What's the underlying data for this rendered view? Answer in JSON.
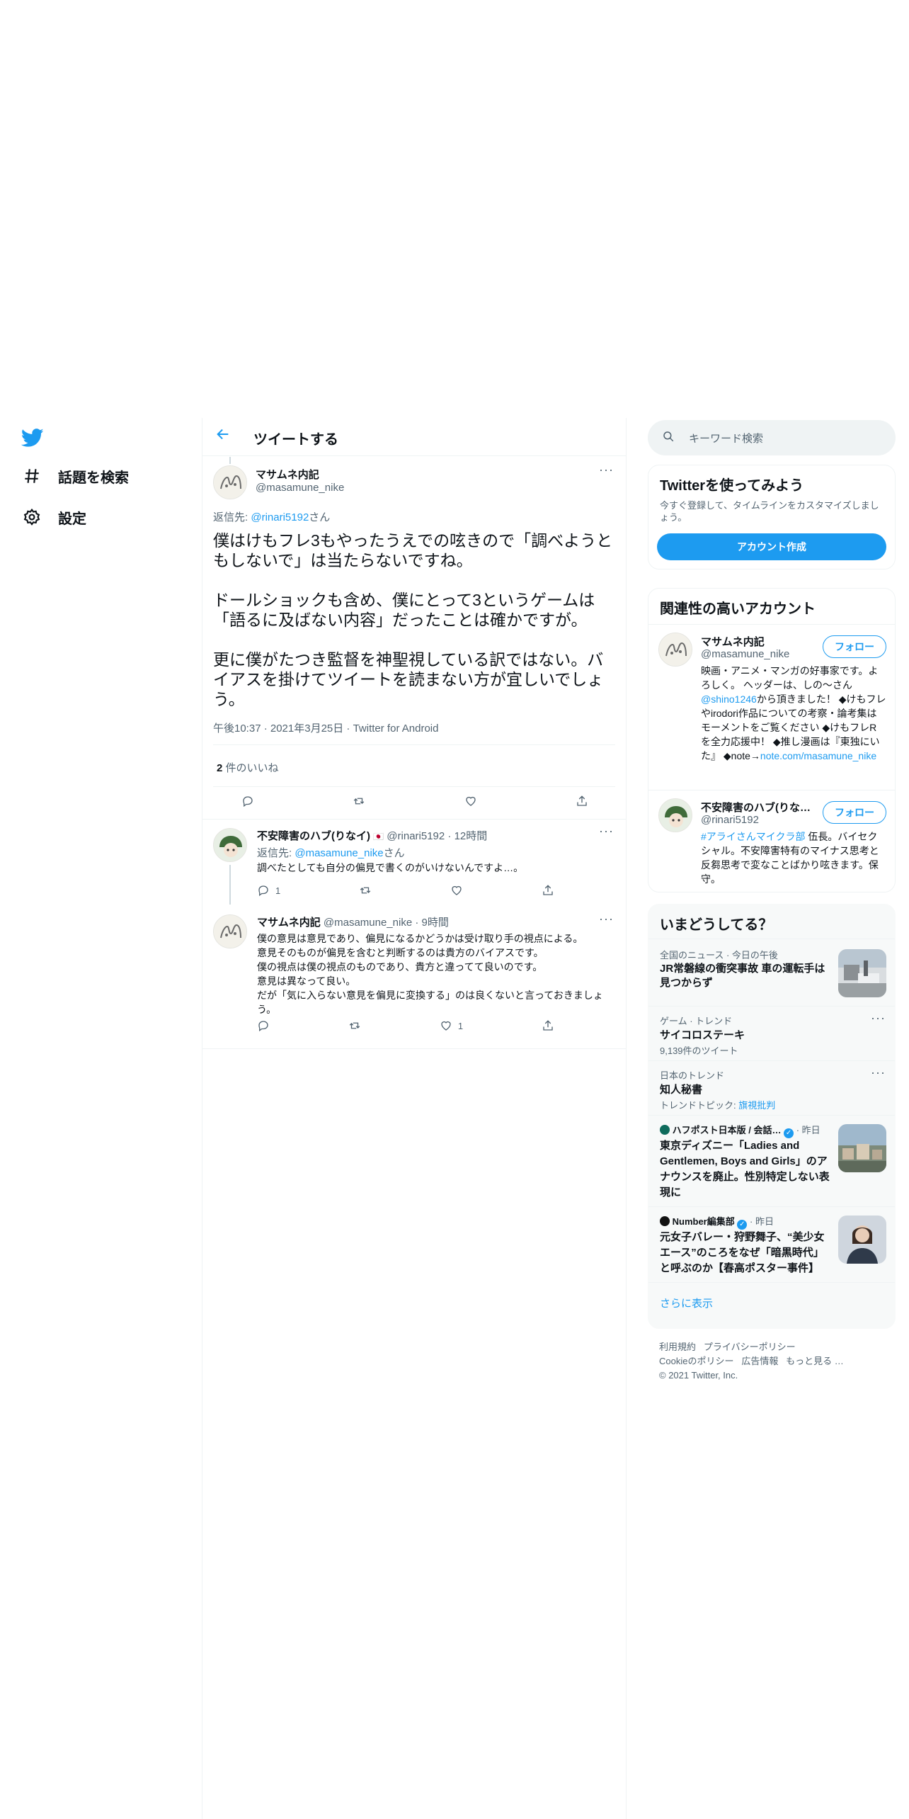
{
  "colors": {
    "accent": "#1d9bf0",
    "text": "#0f1419",
    "muted": "#536471",
    "border": "#eff3f4"
  },
  "nav": {
    "logo": "twitter-bird-icon",
    "items": [
      {
        "icon": "hashtag-icon",
        "label": "話題を検索"
      },
      {
        "icon": "gear-icon",
        "label": "設定"
      }
    ]
  },
  "main": {
    "title": "ツイートする",
    "tweet": {
      "name": "マサムネ内記",
      "handle": "@masamune_nike",
      "reply_prefix": "返信先:",
      "reply_to": "@rinari5192",
      "reply_suffix": "さん",
      "text": "僕はけもフレ3もやったうえでの呟きので「調べようともしないで」は当たらないですね。\n\nドールショックも含め、僕にとって3というゲームは「語るに及ばない内容」だったことは確かですが。\n\n更に僕がたつき監督を神聖視している訳ではない。バイアスを掛けてツイートを読まない方が宜しいでしょう。",
      "timestamp": "午後10:37 · 2021年3月25日 · Twitter for Android",
      "likes_count": "2",
      "likes_label": "件のいいね"
    },
    "replies": [
      {
        "name": "不安障害のハブ(りなイ)",
        "badge": "🇯🇵",
        "handle": "@rinari5192",
        "time": "· 12時間",
        "reply_prefix": "返信先:",
        "reply_to": "@masamune_nike",
        "reply_suffix": "さん",
        "text": "調べたとしても自分の偏見で書くのがいけないんですよ…。",
        "reply_count": "1",
        "retweet_count": "",
        "like_count": ""
      },
      {
        "name": "マサムネ内記",
        "handle": "@masamune_nike",
        "time": "· 9時間",
        "text": "僕の意見は意見であり、偏見になるかどうかは受け取り手の視点による。\n意見そのものが偏見を含むと判断するのは貴方のバイアスです。\n僕の視点は僕の視点のものであり、貴方と違ってて良いのです。\n意見は異なって良い。\nだが「気に入らない意見を偏見に変換する」のは良くないと言っておきましょう。",
        "reply_count": "",
        "retweet_count": "",
        "like_count": "1"
      }
    ]
  },
  "right": {
    "search_placeholder": "キーワード検索",
    "signup": {
      "title": "Twitterを使ってみよう",
      "desc": "今すぐ登録して、タイムラインをカスタマイズしましょう。",
      "button": "アカウント作成"
    },
    "related": {
      "title": "関連性の高いアカウント",
      "follow_label": "フォロー",
      "accounts": [
        {
          "name": "マサムネ内記",
          "handle": "@masamune_nike",
          "bio_1": "映画・アニメ・マンガの好事家です。よろしく。 ヘッダーは、しの〜さん",
          "bio_mention": "@shino1246",
          "bio_2": "から頂きました！ ◆けもフレやirodori作品についての考察・論考集はモーメントをご覧ください ◆けもフレRを全力応援中！ ◆推し漫画は『東独にいた』 ◆note→",
          "bio_link": "note.com/masamune_nike"
        },
        {
          "name": "不安障害のハブ(りな…",
          "handle": "@rinari5192",
          "bio_hashtag": "#アライさんマイクラ部",
          "bio_rest": " 伍長。バイセクシャル。不安障害特有のマイナス思考と反芻思考で変なことばかり呟きます。保守。"
        }
      ]
    },
    "trends": {
      "title": "いまどうしてる？",
      "items": [
        {
          "meta": "全国のニュース · 今日の午後",
          "title": "JR常磐線の衝突事故 車の運転手は見つからず",
          "thumb": "train-crash-photo"
        },
        {
          "meta": "ゲーム · トレンド",
          "title": "サイコロステーキ",
          "sub": "9,139件のツイート"
        },
        {
          "meta": "日本のトレンド",
          "title": "知人秘書",
          "sub_prefix": "トレンドトピック: ",
          "sub_link": "旗視批判"
        },
        {
          "source": "ハフポスト日本版 / 会話…",
          "meta": "· 昨日",
          "title": "東京ディズニー「Ladies and Gentlemen, Boys and Girls」のアナウンスを廃止。性別特定しない表現に",
          "thumb": "disney-resort-photo"
        },
        {
          "source": "Number編集部",
          "meta": "· 昨日",
          "title": "元女子バレー・狩野舞子、“美少女エース”のころをなぜ「暗黒時代」と呼ぶのか【春高ポスター事件】",
          "thumb": "athlete-portrait-photo"
        }
      ],
      "more": "さらに表示"
    },
    "footer": {
      "line1": [
        "利用規約",
        "プライバシーポリシー"
      ],
      "line2": [
        "Cookieのポリシー",
        "広告情報",
        "もっと見る …"
      ],
      "copyright": "© 2021 Twitter, Inc."
    }
  }
}
